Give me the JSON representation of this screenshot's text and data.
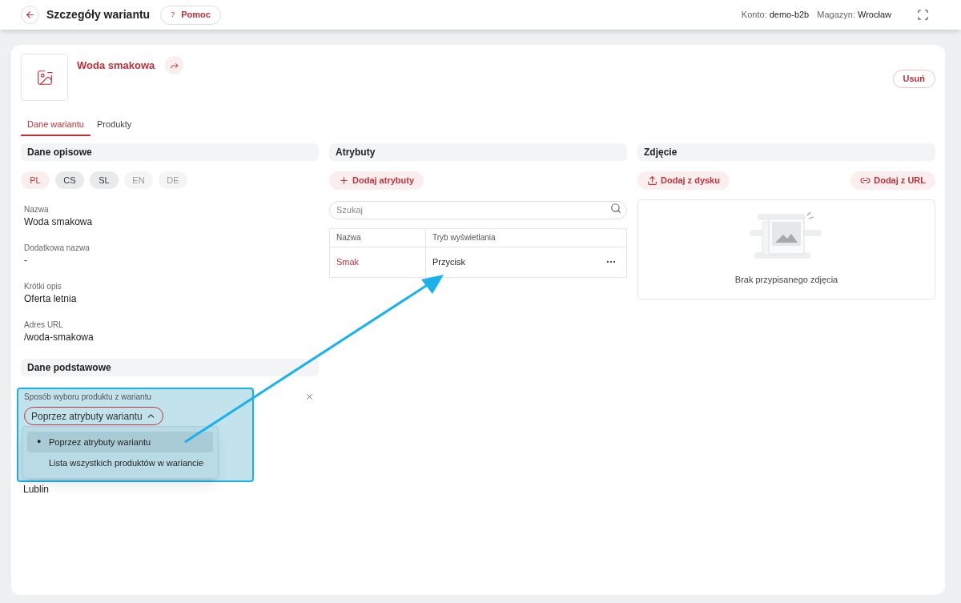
{
  "header": {
    "title": "Szczegóły wariantu",
    "help_button": {
      "icon": "?",
      "label": "Pomoc"
    },
    "account": {
      "label": "Konto:",
      "value": "demo-b2b"
    },
    "warehouse": {
      "label": "Magazyn:",
      "value": "Wrocław"
    }
  },
  "variant": {
    "name": "Woda smakowa",
    "delete_button": "Usuń"
  },
  "tabs": [
    {
      "label": "Dane wariantu",
      "selected": true
    },
    {
      "label": "Produkty",
      "selected": false
    }
  ],
  "descriptive": {
    "title": "Dane opisowe",
    "languages": [
      {
        "code": "PL",
        "selected": true,
        "available": true
      },
      {
        "code": "CS",
        "selected": false,
        "available": true
      },
      {
        "code": "SL",
        "selected": false,
        "available": true
      },
      {
        "code": "EN",
        "selected": false,
        "available": false
      },
      {
        "code": "DE",
        "selected": false,
        "available": false
      }
    ],
    "fields": [
      {
        "label": "Nazwa",
        "value": "Woda smakowa"
      },
      {
        "label": "Dodatkowa nazwa",
        "value": "-"
      },
      {
        "label": "Krótki opis",
        "value": "Oferta letnia"
      },
      {
        "label": "Adres URL",
        "value": "/woda-smakowa"
      }
    ]
  },
  "basic": {
    "title": "Dane podstawowe",
    "selection_field": {
      "label": "Sposób wyboru produktu z wariantu",
      "value": "Poprzez atrybuty wariantu",
      "expanded": true,
      "selected_marker": "●",
      "options": [
        {
          "label": "Poprzez atrybuty wariantu",
          "selected": true
        },
        {
          "label": "Lista wszystkich produktów w wariancie",
          "selected": false
        }
      ]
    },
    "warehouse_value": "Lublin"
  },
  "attributes": {
    "title": "Atrybuty",
    "add_button": "Dodaj atrybuty",
    "search": {
      "placeholder": "Szukaj"
    },
    "columns": [
      "Nazwa",
      "Tryb wyświetlania"
    ],
    "rows": [
      {
        "name": "Smak",
        "display_mode": "Przycisk"
      }
    ]
  },
  "photo": {
    "title": "Zdjęcie",
    "buttons": [
      {
        "kind": "upload",
        "label": "Dodaj z dysku"
      },
      {
        "kind": "link",
        "label": "Dodaj z URL"
      }
    ],
    "empty_text": "Brak przypisanego zdjęcia"
  }
}
